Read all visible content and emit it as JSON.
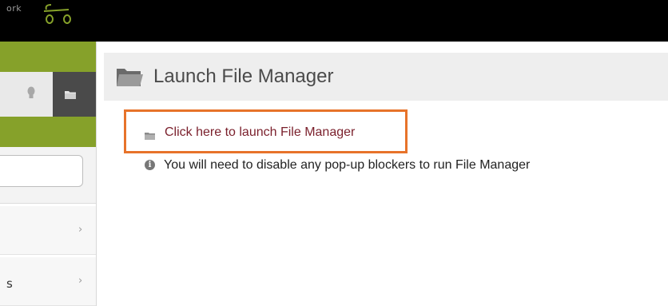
{
  "topbar": {
    "brand_fragment": "ork"
  },
  "sidebar": {
    "tools": [
      {
        "icon": "lightbulb-icon"
      },
      {
        "icon": "folder-icon"
      }
    ],
    "search": {
      "placeholder": ""
    },
    "nav_items": [
      {
        "label": "",
        "icon": "chevron-right-icon"
      },
      {
        "label": "s",
        "icon": "chevron-right-icon"
      }
    ]
  },
  "main": {
    "title": "Launch File Manager",
    "title_icon": "folder-open-icon",
    "launch_link": "Click here to launch File Manager",
    "launch_icon": "folder-icon",
    "note": "You will need to disable any pop-up blockers to run File Manager",
    "note_icon": "info-icon"
  },
  "colors": {
    "accent_green": "#86a12a",
    "link": "#7a1f2b",
    "highlight_border": "#e7732a"
  }
}
